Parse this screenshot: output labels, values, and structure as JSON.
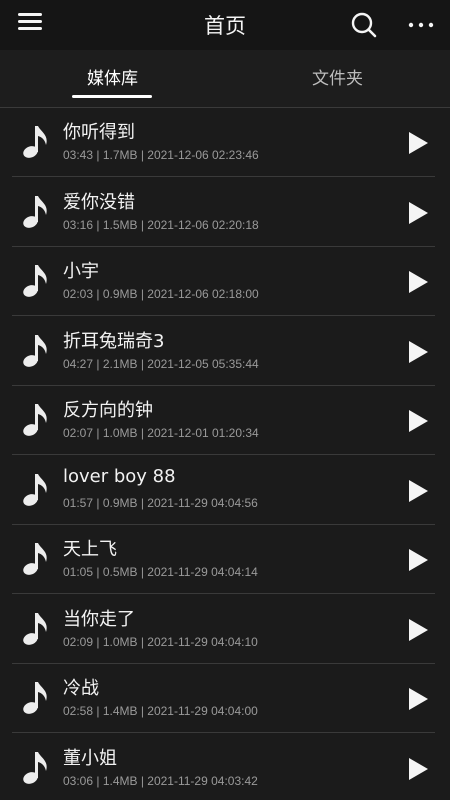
{
  "header": {
    "title": "首页",
    "menu_icon": "hamburger-menu-icon",
    "search_icon": "search-icon",
    "more_icon": "more-dots-icon"
  },
  "tabs": [
    {
      "label": "媒体库",
      "active": true
    },
    {
      "label": "文件夹",
      "active": false
    }
  ],
  "songs": [
    {
      "title": "你听得到",
      "duration": "03:43",
      "size": "1.7MB",
      "date": "2021-12-06 02:23:46"
    },
    {
      "title": "爱你没错",
      "duration": "03:16",
      "size": "1.5MB",
      "date": "2021-12-06 02:20:18"
    },
    {
      "title": "小宇",
      "duration": "02:03",
      "size": "0.9MB",
      "date": "2021-12-06 02:18:00"
    },
    {
      "title": "折耳兔瑞奇3",
      "duration": "04:27",
      "size": "2.1MB",
      "date": "2021-12-05 05:35:44"
    },
    {
      "title": "反方向的钟",
      "duration": "02:07",
      "size": "1.0MB",
      "date": "2021-12-01 01:20:34"
    },
    {
      "title": "lover boy 88",
      "duration": "01:57",
      "size": "0.9MB",
      "date": "2021-11-29 04:04:56"
    },
    {
      "title": "天上飞",
      "duration": "01:05",
      "size": "0.5MB",
      "date": "2021-11-29 04:04:14"
    },
    {
      "title": "当你走了",
      "duration": "02:09",
      "size": "1.0MB",
      "date": "2021-11-29 04:04:10"
    },
    {
      "title": "冷战",
      "duration": "02:58",
      "size": "1.4MB",
      "date": "2021-11-29 04:04:00"
    },
    {
      "title": "董小姐",
      "duration": "03:06",
      "size": "1.4MB",
      "date": "2021-11-29 04:03:42"
    }
  ],
  "colors": {
    "background": "#1b1b1b",
    "text": "#f2f2f2",
    "meta_text": "#9a9a9a",
    "divider": "#3a3a3a"
  }
}
